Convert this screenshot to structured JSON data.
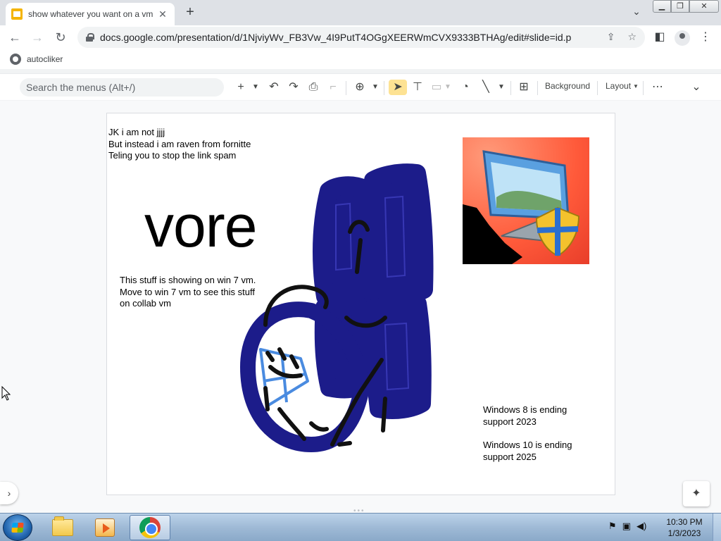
{
  "browser": {
    "tab_title": "show whatever you want on a vm",
    "tab_close": "✕",
    "new_tab": "+",
    "url": "docs.google.com/presentation/d/1NjviyWv_FB3Vw_4I9PutT4OGgXEERWmCVX9333BTHAg/edit#slide=id.p",
    "bookmark": "autocliker"
  },
  "slides_toolbar": {
    "search_placeholder": "Search the menus (Alt+/)",
    "background_label": "Background",
    "layout_label": "Layout"
  },
  "slide": {
    "intro_lines": [
      "JK i am not jjjj",
      "But instead i am raven from fornitte",
      "Teling you to stop the link spam"
    ],
    "big_word": "vore",
    "vm_lines": [
      "This stuff is showing on win 7 vm.",
      "Move to win 7 vm to see this stuff",
      "on collab vm"
    ],
    "win8_lines": [
      "Windows 8  is ending",
      "support 2023"
    ],
    "win10_lines": [
      "Windows 10 is ending",
      "support 2025"
    ]
  },
  "taskbar": {
    "time": "10:30 PM",
    "date": "1/3/2023"
  },
  "icons": [
    "slides-favicon",
    "back-icon",
    "forward-icon",
    "reload-icon",
    "lock-icon",
    "share-icon",
    "star-icon",
    "sidepanel-icon",
    "profile-icon",
    "menu-icon",
    "add-icon",
    "undo-icon",
    "redo-icon",
    "print-icon",
    "paint-format-icon",
    "zoom-icon",
    "select-icon",
    "textbox-icon",
    "image-icon",
    "shape-icon",
    "line-icon",
    "comment-icon",
    "more-icon",
    "collapse-icon",
    "explore-icon",
    "start-orb-icon",
    "folder-icon",
    "media-player-icon",
    "chrome-icon",
    "flag-icon",
    "network-icon",
    "volume-icon"
  ]
}
